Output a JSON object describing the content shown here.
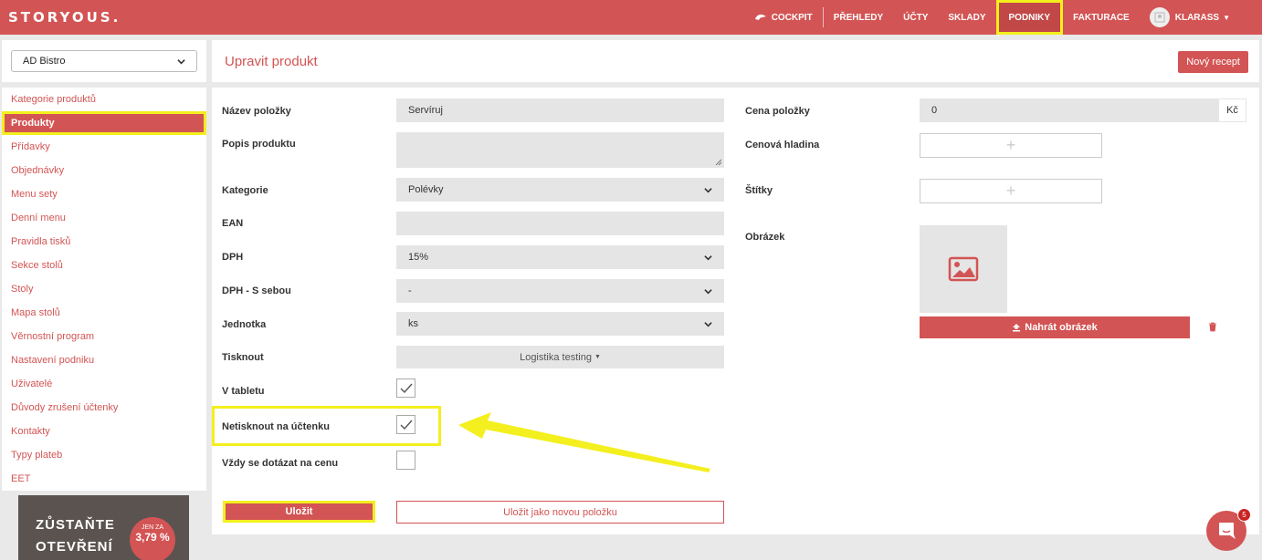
{
  "brand": {
    "logo": "STORYOUS.",
    "accent": "#d35454",
    "highlight": "#f4ef1e"
  },
  "nav": {
    "cockpit": "COCKPIT",
    "items": [
      "PŘEHLEDY",
      "ÚČTY",
      "SKLADY",
      "PODNIKY",
      "FAKTURACE"
    ],
    "active": "PODNIKY",
    "user": "KLARASS"
  },
  "sidebar": {
    "venue": "AD Bistro",
    "items": [
      "Kategorie produktů",
      "Produkty",
      "Přídavky",
      "Objednávky",
      "Menu sety",
      "Denní menu",
      "Pravidla tisků",
      "Sekce stolů",
      "Stoly",
      "Mapa stolů",
      "Věrnostní program",
      "Nastavení podniku",
      "Uživatelé",
      "Důvody zrušení účtenky",
      "Kontakty",
      "Typy plateb",
      "EET"
    ],
    "active_index": 1,
    "ad": {
      "line1": "ZŮSTAŇTE",
      "line2": "OTEVŘENÍ",
      "badge_top": "JEN ZA",
      "badge_value": "3,79 %"
    }
  },
  "header": {
    "title": "Upravit produkt",
    "new_button": "Nový recept"
  },
  "form": {
    "name_label": "Název položky",
    "name_value": "Servíruj",
    "desc_label": "Popis produktu",
    "desc_value": "",
    "category_label": "Kategorie",
    "category_value": "Polévky",
    "ean_label": "EAN",
    "ean_value": "",
    "vat_label": "DPH",
    "vat_value": "15%",
    "vat_takeaway_label": "DPH - S sebou",
    "vat_takeaway_value": "-",
    "unit_label": "Jednotka",
    "unit_value": "ks",
    "print_label": "Tisknout",
    "print_value": "Logistika testing",
    "tablet_label": "V tabletu",
    "tablet_checked": true,
    "noprint_label": "Netisknout na účtenku",
    "noprint_checked": true,
    "askprice_label": "Vždy se dotázat na cenu",
    "askprice_checked": false,
    "price_label": "Cena položky",
    "price_value": "0",
    "currency": "Kč",
    "price_level_label": "Cenová hladina",
    "tags_label": "Štítky",
    "image_label": "Obrázek",
    "upload_button": "Nahrát obrázek",
    "save_button": "Uložit",
    "save_new_button": "Uložit jako novou položku"
  },
  "chat": {
    "badge": "5"
  }
}
